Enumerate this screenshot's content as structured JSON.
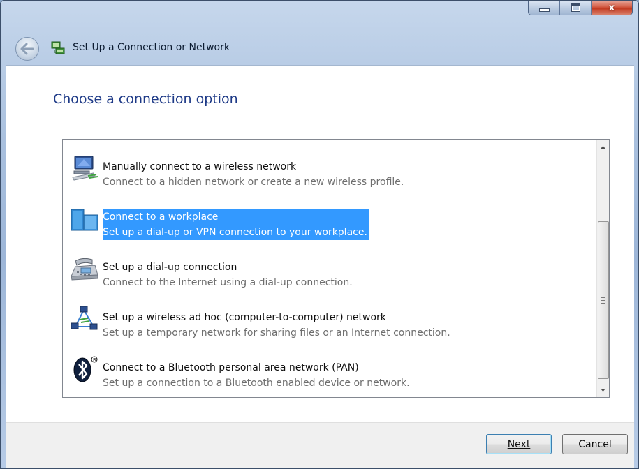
{
  "window": {
    "title": "Set Up a Connection or Network",
    "controls": {
      "minimize": "minimize",
      "maximize": "maximize",
      "close": "x"
    }
  },
  "main": {
    "heading": "Choose a connection option",
    "options": [
      {
        "title": "Manually connect to a wireless network",
        "description": "Connect to a hidden network or create a new wireless profile.",
        "icon": "wireless-computer-icon",
        "selected": false
      },
      {
        "title": "Connect to a workplace",
        "description": "Set up a dial-up or VPN connection to your workplace.",
        "icon": "workplace-icon",
        "selected": true
      },
      {
        "title": "Set up a dial-up connection",
        "description": "Connect to the Internet using a dial-up connection.",
        "icon": "telephone-icon",
        "selected": false
      },
      {
        "title": "Set up a wireless ad hoc (computer-to-computer) network",
        "description": "Set up a temporary network for sharing files or an Internet connection.",
        "icon": "adhoc-network-icon",
        "selected": false
      },
      {
        "title": "Connect to a Bluetooth personal area network (PAN)",
        "description": "Set up a connection to a Bluetooth enabled device or network.",
        "icon": "bluetooth-icon",
        "selected": false
      }
    ]
  },
  "footer": {
    "next_label": "Next",
    "cancel_label": "Cancel"
  },
  "colors": {
    "selection": "#3399ff",
    "heading": "#1e3a87",
    "close_button": "#c2391f"
  }
}
